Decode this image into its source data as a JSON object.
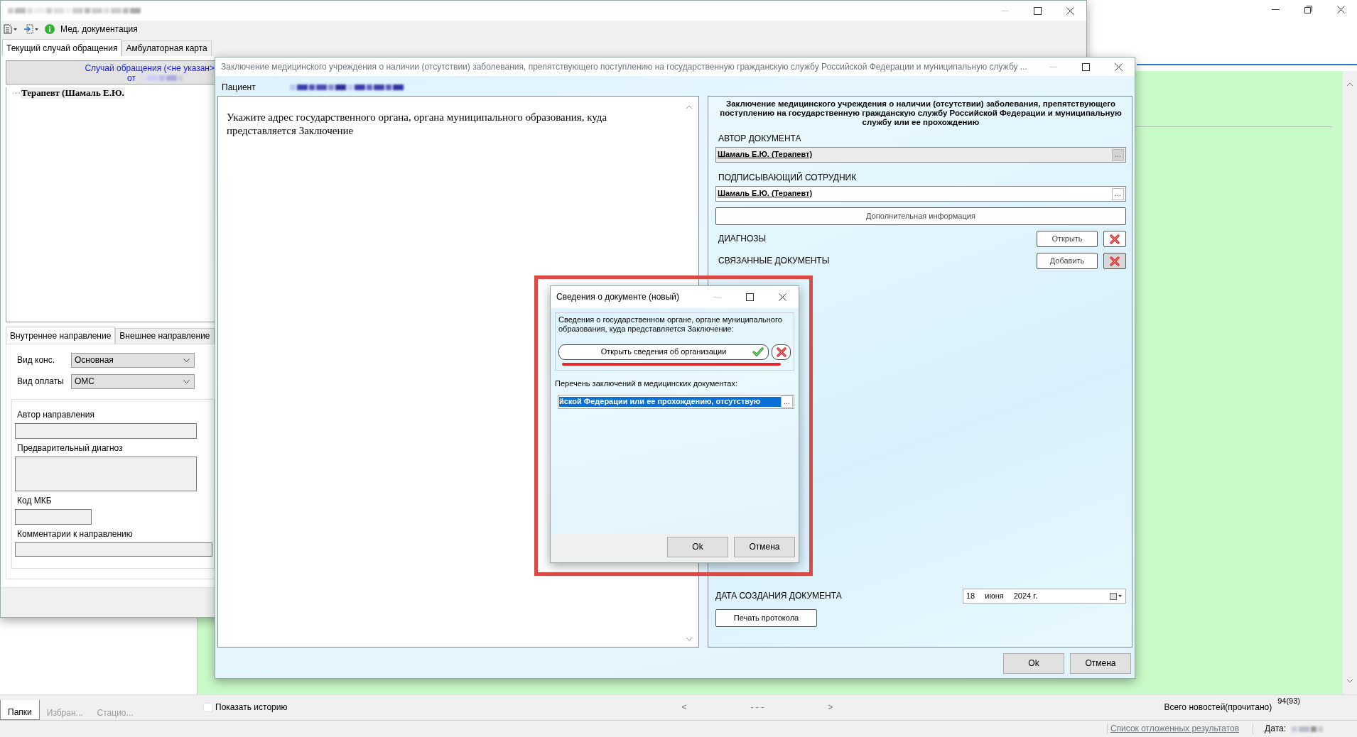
{
  "background_window": {
    "bottom_tabs": [
      {
        "label": "Папки",
        "selected": true
      },
      {
        "label": "Избран...",
        "selected": false
      },
      {
        "label": "Стацио...",
        "selected": false
      }
    ],
    "show_history": {
      "label": "Показать историю",
      "checked": false
    },
    "pager": {
      "prev": "<",
      "pages": "- - -",
      "next": ">"
    },
    "news": {
      "label": "Всего новостей(прочитано)",
      "count": "94(93)"
    },
    "status_bar": {
      "link": "Список отложенных результатов",
      "date_label": "Дата:"
    }
  },
  "med_window": {
    "toolbar_title": "Мед. документация",
    "tabs": [
      {
        "label": "Текущий случай обращения",
        "selected": true
      },
      {
        "label": "Амбулаторная карта",
        "selected": false
      }
    ],
    "case_link": "Случай обращения (<не указан>",
    "case_date_prefix": "от",
    "tree": [
      {
        "label": "Терапевт (Шамаль Е.Ю."
      }
    ],
    "referral_tabs": [
      {
        "label": "Внутреннее направление",
        "selected": true
      },
      {
        "label": "Внешнее направление",
        "selected": false
      }
    ],
    "selects": [
      {
        "label": "Вид конс.",
        "value": "Основная"
      },
      {
        "label": "Вид оплаты",
        "value": "ОМС"
      }
    ],
    "fields": [
      {
        "label": "Автор направления",
        "kind": "line"
      },
      {
        "label": "Предварительный диагноз",
        "kind": "area"
      },
      {
        "label": "Код МКБ",
        "kind": "short"
      },
      {
        "label": "Комментарии к направлению",
        "kind": "wide"
      }
    ]
  },
  "conclusion_dialog": {
    "title": "Заключение медицинского учреждения о наличии (отсутствии) заболевания, препятствующего поступлению на государственную гражданскую службу Российской Федерации и муниципальную службу ...",
    "patient_label": "Пациент",
    "prompt": "Укажите адрес государственного органа, органа муниципального образования, куда представляется Заключение",
    "heading": "Заключение медицинского учреждения о наличии (отсутствии) заболевания, препятствующего поступлению на государственную гражданскую службу Российской Федерации и муниципальную службу или ее прохождению",
    "people": [
      {
        "label": "АВТОР ДОКУМЕНТА",
        "value": "Шамаль Е.Ю. (Терапевт)",
        "button": "...",
        "disabled": true
      },
      {
        "label": "ПОДПИСЫВАЮЩИЙ СОТРУДНИК",
        "value": "Шамаль Е.Ю. (Терапевт)",
        "button": "...",
        "disabled": false
      }
    ],
    "extra_info_button": "Дополнительная информация",
    "sections": [
      {
        "label": "ДИАГНОЗЫ",
        "button": "Открыть"
      },
      {
        "label": "СВЯЗАННЫЕ ДОКУМЕНТЫ",
        "button": "Добавить"
      }
    ],
    "date": {
      "label": "ДАТА СОЗДАНИЯ ДОКУМЕНТА",
      "day": "18",
      "month": "июня",
      "year": "2024 г."
    },
    "print_button": "Печать протокола",
    "buttons": [
      "Ok",
      "Отмена"
    ]
  },
  "document_dialog": {
    "title": "Сведения о документе (новый)",
    "group_label": "Сведения о государственном органе, органе муниципального образования, куда представляется Заключение:",
    "org_button": "Открыть сведения об организации",
    "org_confirmed": true,
    "list_label": "Перечень заключений в медицинских документах:",
    "list_value": "йской  Федерации или ее прохождению, отсутствую",
    "list_selected": true,
    "list_button": "...",
    "buttons": [
      "Ok",
      "Отмена"
    ]
  }
}
